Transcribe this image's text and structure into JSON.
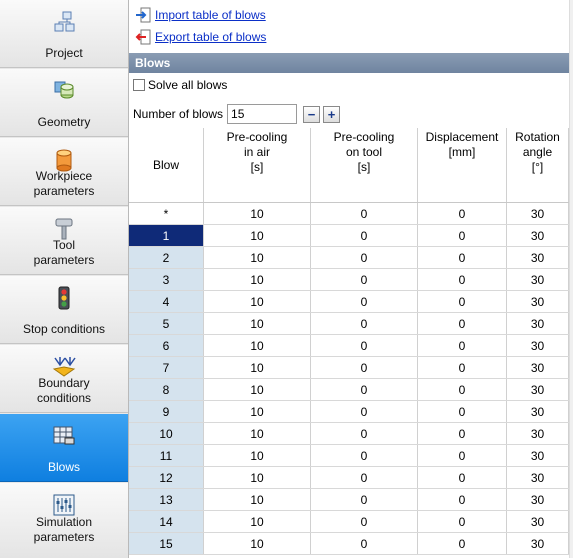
{
  "sidebar": {
    "items": [
      {
        "label": "Project",
        "icon": "project-icon"
      },
      {
        "label": "Geometry",
        "icon": "geometry-icon"
      },
      {
        "label": "Workpiece\nparameters",
        "icon": "workpiece-icon"
      },
      {
        "label": "Tool\nparameters",
        "icon": "tool-icon"
      },
      {
        "label": "Stop conditions",
        "icon": "traffic-light-icon"
      },
      {
        "label": "Boundary\nconditions",
        "icon": "boundary-icon"
      },
      {
        "label": "Blows",
        "icon": "blows-icon",
        "active": true
      },
      {
        "label": "Simulation\nparameters",
        "icon": "simulation-icon"
      }
    ]
  },
  "main": {
    "import_label": "Import table of blows",
    "export_label": "Export table of blows",
    "section_title": "Blows",
    "solve_all_label": "Solve all blows",
    "number_of_blows_label": "Number of blows",
    "number_of_blows_value": "15",
    "minus_label": "−",
    "plus_label": "+"
  },
  "table": {
    "columns": [
      "Blow",
      "Pre-cooling\nin air\n[s]",
      "Pre-cooling\non tool\n[s]",
      "Displacement\n[mm]",
      "Rotation\nangle\n[°]"
    ],
    "rows": [
      [
        "*",
        "10",
        "0",
        "0",
        "30"
      ],
      [
        "1",
        "10",
        "0",
        "0",
        "30"
      ],
      [
        "2",
        "10",
        "0",
        "0",
        "30"
      ],
      [
        "3",
        "10",
        "0",
        "0",
        "30"
      ],
      [
        "4",
        "10",
        "0",
        "0",
        "30"
      ],
      [
        "5",
        "10",
        "0",
        "0",
        "30"
      ],
      [
        "6",
        "10",
        "0",
        "0",
        "30"
      ],
      [
        "7",
        "10",
        "0",
        "0",
        "30"
      ],
      [
        "8",
        "10",
        "0",
        "0",
        "30"
      ],
      [
        "9",
        "10",
        "0",
        "0",
        "30"
      ],
      [
        "10",
        "10",
        "0",
        "0",
        "30"
      ],
      [
        "11",
        "10",
        "0",
        "0",
        "30"
      ],
      [
        "12",
        "10",
        "0",
        "0",
        "30"
      ],
      [
        "13",
        "10",
        "0",
        "0",
        "30"
      ],
      [
        "14",
        "10",
        "0",
        "0",
        "30"
      ],
      [
        "15",
        "10",
        "0",
        "0",
        "30"
      ]
    ]
  },
  "colors": {
    "active_nav": "#1585e6",
    "link": "#0b2fc7",
    "section_bar": "#7b8ea8",
    "selected_row": "#0f2a78",
    "row_header": "#d5e3ee"
  }
}
